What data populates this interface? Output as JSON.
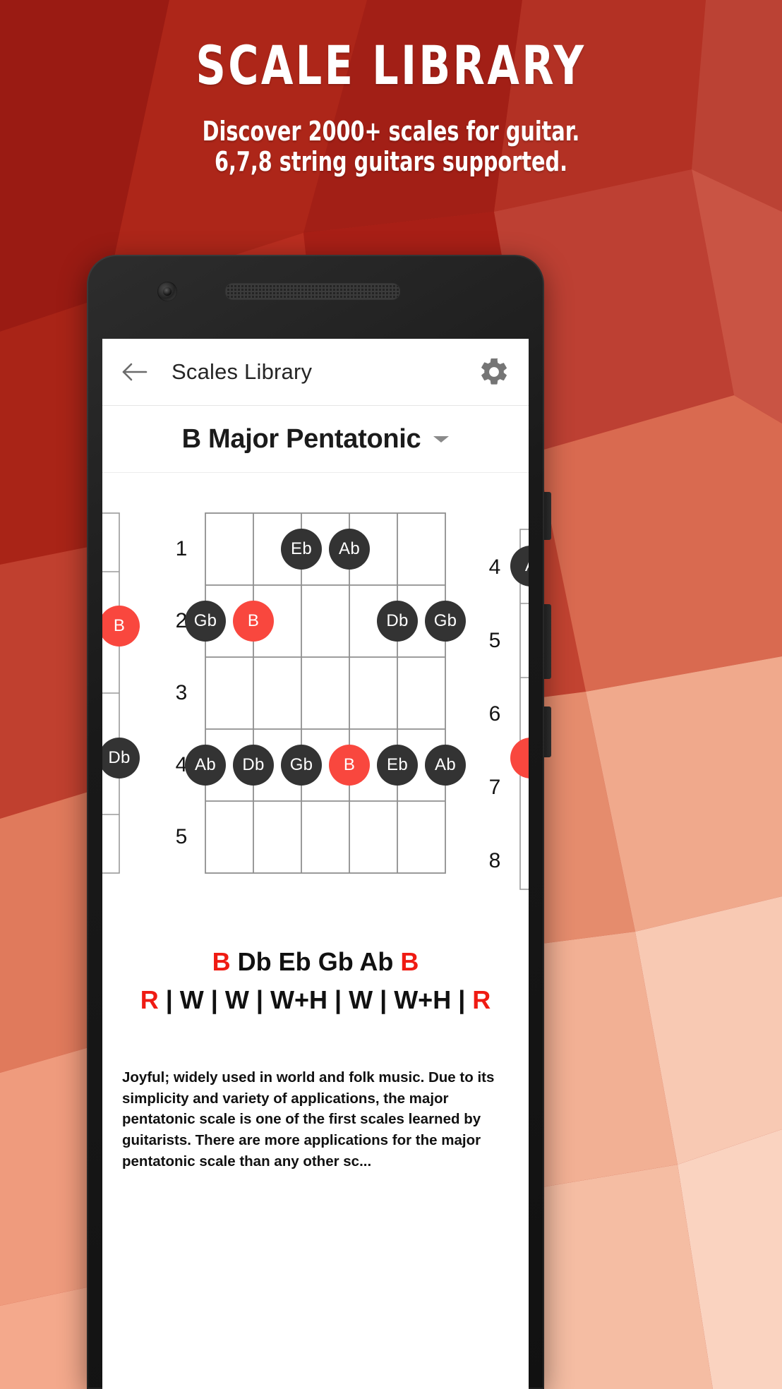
{
  "hero": {
    "title": "SCALE LIBRARY",
    "subtitle_line1": "Discover 2000+ scales for guitar.",
    "subtitle_line2": "6,7,8 string guitars supported."
  },
  "colors": {
    "background_dark_red": "#9e1e16",
    "background_mid_red": "#b52a1d",
    "background_salmon": "#e8836b",
    "background_light": "#f6c3b0",
    "accent_red": "#f9473e",
    "note_dark": "#333333",
    "text_red": "#ef1b13"
  },
  "phone": {
    "camera_icon": "camera-icon",
    "speaker_icon": "earpiece-speaker-icon"
  },
  "app": {
    "appbar": {
      "back_icon": "back-arrow-icon",
      "title": "Scales Library",
      "settings_icon": "gear-icon"
    },
    "scale_selector": {
      "name": "B Major Pentatonic",
      "caret_icon": "chevron-down-icon"
    },
    "fretboard": {
      "left_fret_labels": [],
      "center_fret_labels": [
        "1",
        "2",
        "3",
        "4",
        "5"
      ],
      "right_fret_labels": [
        "4",
        "5",
        "6",
        "7",
        "8"
      ],
      "left_partial_notes": [
        {
          "label": "B",
          "root": true
        },
        {
          "label": "Db",
          "root": false
        }
      ],
      "right_partial_notes": [
        {
          "label": "A",
          "root": false
        },
        {
          "label": "",
          "root": true
        }
      ],
      "notes": [
        {
          "fret": 1,
          "string": 3,
          "label": "Eb",
          "root": false
        },
        {
          "fret": 1,
          "string": 4,
          "label": "Ab",
          "root": false
        },
        {
          "fret": 2,
          "string": 1,
          "label": "Gb",
          "root": false
        },
        {
          "fret": 2,
          "string": 2,
          "label": "B",
          "root": true
        },
        {
          "fret": 2,
          "string": 5,
          "label": "Db",
          "root": false
        },
        {
          "fret": 2,
          "string": 6,
          "label": "Gb",
          "root": false
        },
        {
          "fret": 4,
          "string": 1,
          "label": "Ab",
          "root": false
        },
        {
          "fret": 4,
          "string": 2,
          "label": "Db",
          "root": false
        },
        {
          "fret": 4,
          "string": 3,
          "label": "Gb",
          "root": false
        },
        {
          "fret": 4,
          "string": 4,
          "label": "B",
          "root": true
        },
        {
          "fret": 4,
          "string": 5,
          "label": "Eb",
          "root": false
        },
        {
          "fret": 4,
          "string": 6,
          "label": "Ab",
          "root": false
        }
      ]
    },
    "scale_notes": [
      {
        "text": "B",
        "root": true
      },
      {
        "text": "Db",
        "root": false
      },
      {
        "text": "Eb",
        "root": false
      },
      {
        "text": "Gb",
        "root": false
      },
      {
        "text": "Ab",
        "root": false
      },
      {
        "text": "B",
        "root": true
      }
    ],
    "intervals_line": "R | W | W | W+H | W | W+H | R",
    "intervals": [
      {
        "text": "R",
        "root": true
      },
      {
        "text": "W",
        "root": false
      },
      {
        "text": "W",
        "root": false
      },
      {
        "text": "W+H",
        "root": false
      },
      {
        "text": "W",
        "root": false
      },
      {
        "text": "W+H",
        "root": false
      },
      {
        "text": "R",
        "root": true
      }
    ],
    "description": "Joyful; widely used in world and folk music. Due to its simplicity and variety of applications, the major pentatonic scale is one of the first scales learned by guitarists. There are more applications for the major pentatonic scale than any other sc..."
  }
}
